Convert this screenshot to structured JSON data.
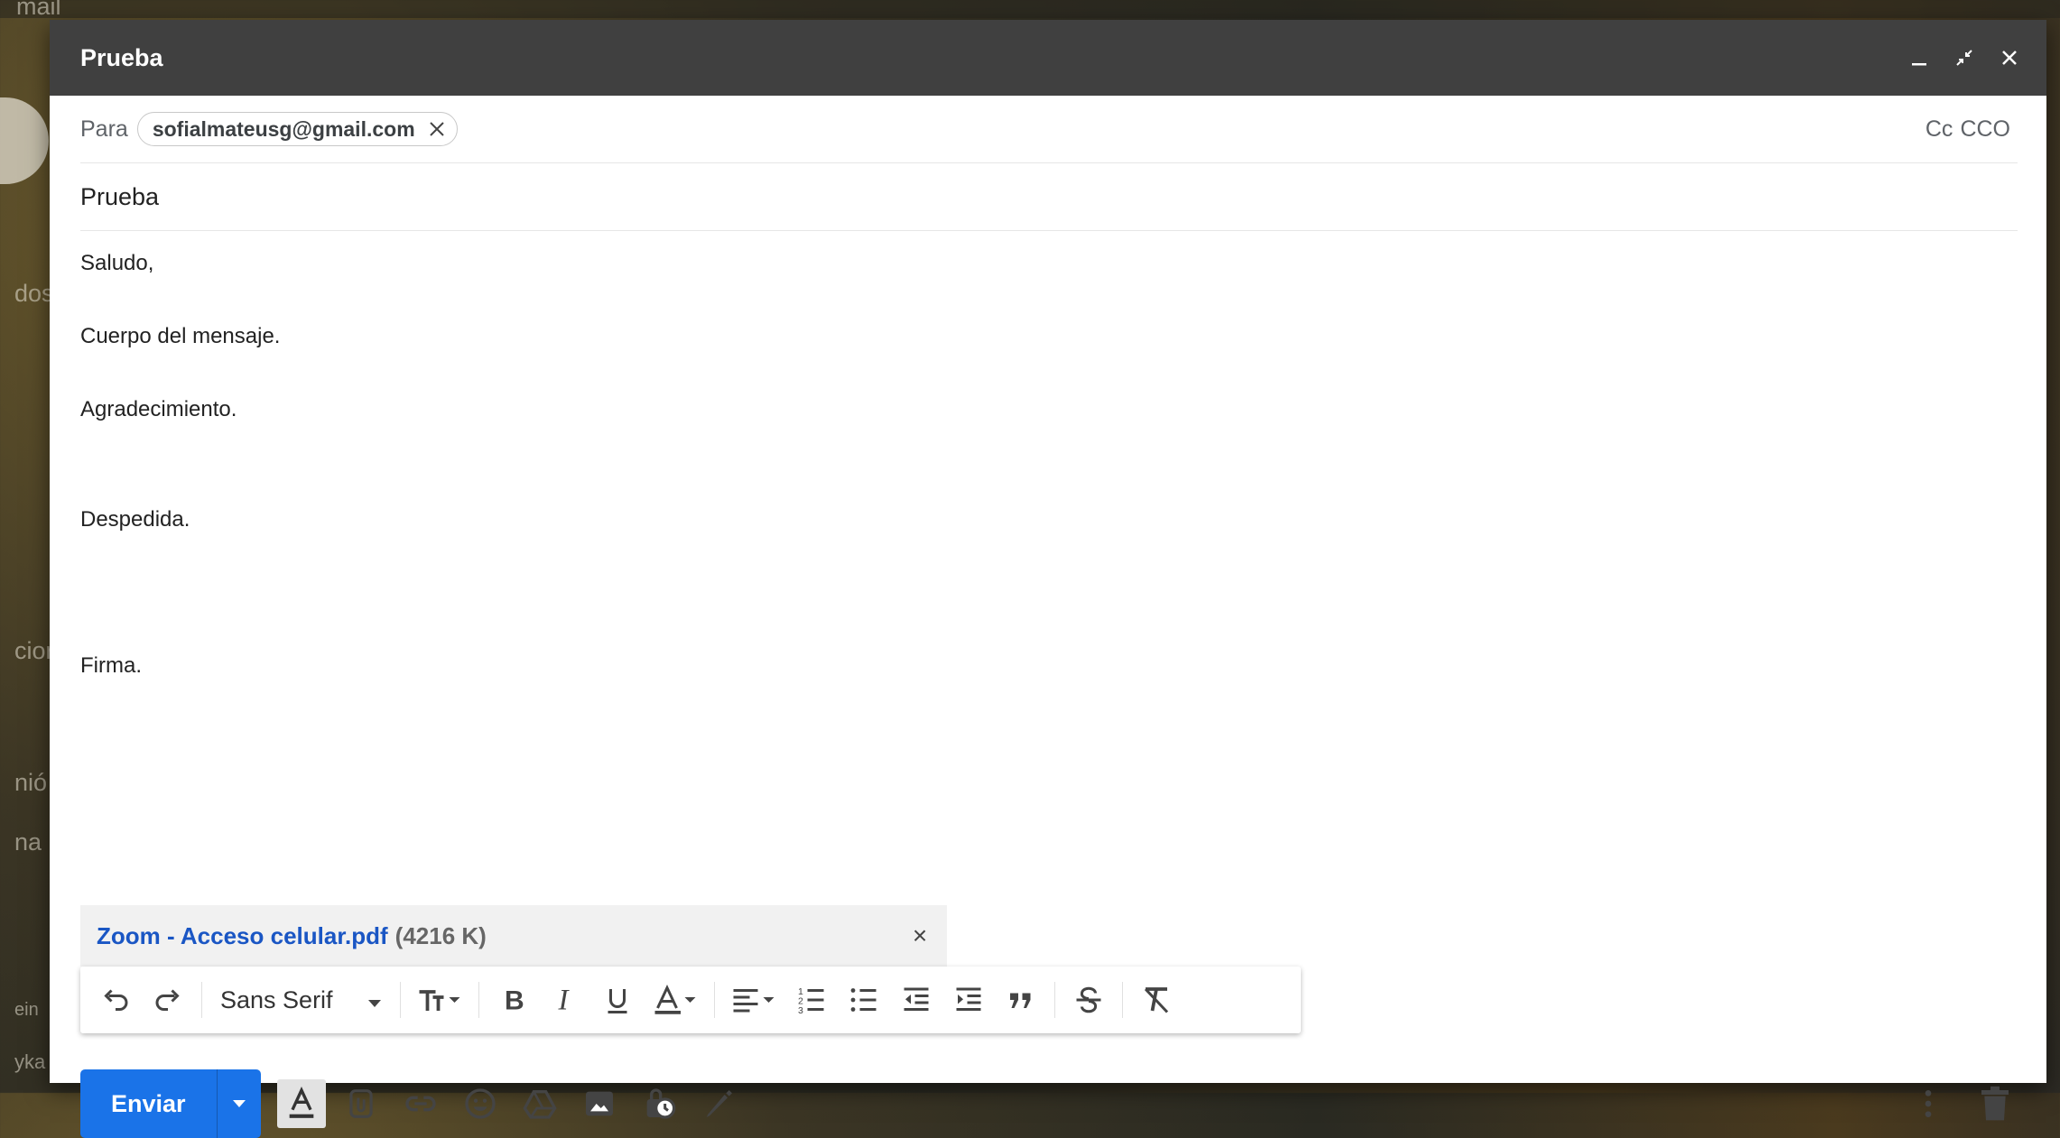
{
  "window": {
    "title": "Prueba",
    "controls": [
      "minimize-icon",
      "exit-fullscreen-icon",
      "close-icon"
    ]
  },
  "background_fragments": {
    "top_left": "mail",
    "frag1": "dos",
    "frag2": "cior",
    "frag3": "nió",
    "frag4": "na",
    "frag5": "ein",
    "frag6": "yka"
  },
  "to": {
    "label": "Para",
    "recipients": [
      "sofialmateusg@gmail.com"
    ],
    "cc_label": "Cc",
    "bcc_label": "CCO"
  },
  "subject": "Prueba",
  "body": {
    "lines": [
      "Saludo,",
      "Cuerpo del mensaje.",
      "Agradecimiento.",
      "Despedida.",
      "Firma."
    ]
  },
  "attachment": {
    "name": "Zoom - Acceso celular.pdf",
    "size": "(4216 K)",
    "close": "×"
  },
  "formatting": {
    "font_family": "Sans Serif",
    "buttons": [
      "undo-icon",
      "redo-icon",
      "font-size-icon",
      "bold-icon",
      "italic-icon",
      "underline-icon",
      "text-color-icon",
      "align-icon",
      "numbered-list-icon",
      "bulleted-list-icon",
      "indent-less-icon",
      "indent-more-icon",
      "quote-icon",
      "strikethrough-icon",
      "clear-formatting-icon"
    ]
  },
  "bottom": {
    "send_label": "Enviar",
    "icons": [
      "formatting-options-icon",
      "attach-file-icon",
      "insert-link-icon",
      "emoji-icon",
      "google-drive-icon",
      "insert-photo-icon",
      "confidential-mode-icon",
      "signature-icon"
    ],
    "right_icons": [
      "more-options-icon",
      "discard-draft-icon"
    ]
  },
  "colors": {
    "titlebar": "#404040",
    "send": "#1a73e8",
    "attachment_link": "#1a56c4"
  }
}
